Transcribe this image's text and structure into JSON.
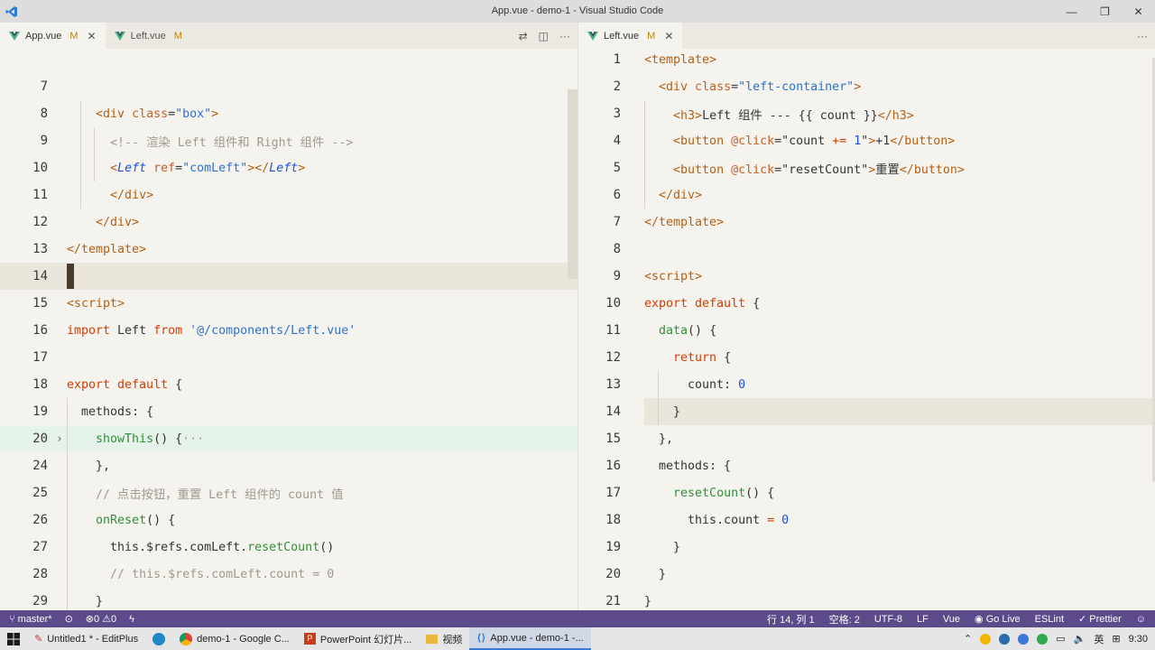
{
  "window": {
    "title": "App.vue - demo-1 - Visual Studio Code"
  },
  "left_group": {
    "tabs": [
      {
        "label": "App.vue",
        "status": "M",
        "active": true
      },
      {
        "label": "Left.vue",
        "status": "M",
        "active": false
      }
    ]
  },
  "right_group": {
    "tabs": [
      {
        "label": "Left.vue",
        "status": "M",
        "active": true
      }
    ]
  },
  "left_lines": [
    {
      "n": "7",
      "parts": []
    },
    {
      "n": "8",
      "parts": [
        [
          "plain",
          "    "
        ],
        [
          "tag",
          "<div "
        ],
        [
          "attr",
          "class"
        ],
        [
          "plain",
          "="
        ],
        [
          "str",
          "\"box\""
        ],
        [
          "tag",
          ">"
        ]
      ]
    },
    {
      "n": "9",
      "parts": [
        [
          "plain",
          "      "
        ],
        [
          "cmt",
          "<!-- 渲染 Left 组件和 Right 组件 -->"
        ]
      ]
    },
    {
      "n": "10",
      "parts": [
        [
          "plain",
          "      "
        ],
        [
          "tag",
          "<"
        ],
        [
          "it",
          "Left "
        ],
        [
          "attr",
          "ref"
        ],
        [
          "plain",
          "="
        ],
        [
          "str",
          "\"comLeft\""
        ],
        [
          "tag",
          "></"
        ],
        [
          "it",
          "Left"
        ],
        [
          "tag",
          ">"
        ]
      ]
    },
    {
      "n": "11",
      "parts": [
        [
          "plain",
          "      "
        ],
        [
          "tag",
          "</div>"
        ]
      ]
    },
    {
      "n": "12",
      "parts": [
        [
          "plain",
          "    "
        ],
        [
          "tag",
          "</div>"
        ]
      ]
    },
    {
      "n": "13",
      "parts": [
        [
          "tag",
          "</template>"
        ]
      ]
    },
    {
      "n": "14",
      "parts": []
    },
    {
      "n": "15",
      "parts": [
        [
          "tag",
          "<script>"
        ]
      ]
    },
    {
      "n": "16",
      "parts": [
        [
          "kw",
          "import "
        ],
        [
          "plain",
          "Left "
        ],
        [
          "kw",
          "from "
        ],
        [
          "str",
          "'@/components/Left.vue'"
        ]
      ]
    },
    {
      "n": "17",
      "parts": []
    },
    {
      "n": "18",
      "parts": [
        [
          "kw",
          "export default "
        ],
        [
          "plain",
          "{"
        ]
      ]
    },
    {
      "n": "19",
      "parts": [
        [
          "plain",
          "  methods: {"
        ]
      ]
    },
    {
      "n": "20",
      "parts": [
        [
          "plain",
          "    "
        ],
        [
          "fn",
          "showThis"
        ],
        [
          "plain",
          "() {"
        ],
        [
          "cmt",
          "···"
        ]
      ]
    },
    {
      "n": "24",
      "parts": [
        [
          "plain",
          "    },"
        ]
      ]
    },
    {
      "n": "25",
      "parts": [
        [
          "plain",
          "    "
        ],
        [
          "cmt",
          "// 点击按钮，重置 Left 组件的 count 值"
        ]
      ]
    },
    {
      "n": "26",
      "parts": [
        [
          "plain",
          "    "
        ],
        [
          "fn",
          "onReset"
        ],
        [
          "plain",
          "() {"
        ]
      ]
    },
    {
      "n": "27",
      "parts": [
        [
          "plain",
          "      this.$refs.comLeft."
        ],
        [
          "fn",
          "resetCount"
        ],
        [
          "plain",
          "()"
        ]
      ]
    },
    {
      "n": "28",
      "parts": [
        [
          "plain",
          "      "
        ],
        [
          "cmt",
          "// this.$refs.comLeft.count = 0"
        ]
      ]
    },
    {
      "n": "29",
      "parts": [
        [
          "plain",
          "    }"
        ]
      ]
    }
  ],
  "right_lines": [
    {
      "n": "1",
      "parts": [
        [
          "tag",
          "<template>"
        ]
      ]
    },
    {
      "n": "2",
      "parts": [
        [
          "plain",
          "  "
        ],
        [
          "tag",
          "<div "
        ],
        [
          "attr",
          "class"
        ],
        [
          "plain",
          "="
        ],
        [
          "str",
          "\"left-container\""
        ],
        [
          "tag",
          ">"
        ]
      ]
    },
    {
      "n": "3",
      "parts": [
        [
          "plain",
          "    "
        ],
        [
          "tag",
          "<h3>"
        ],
        [
          "plain",
          "Left 组件 --- {{ count }}"
        ],
        [
          "tag",
          "</h3>"
        ]
      ]
    },
    {
      "n": "4",
      "parts": [
        [
          "plain",
          "    "
        ],
        [
          "tag",
          "<button "
        ],
        [
          "attr",
          "@click"
        ],
        [
          "plain",
          "=\"count "
        ],
        [
          "kw",
          "+="
        ],
        [
          "plain",
          " "
        ],
        [
          "num",
          "1"
        ],
        [
          "plain",
          "\""
        ],
        [
          "tag",
          ">"
        ],
        [
          "plain",
          "+1"
        ],
        [
          "tag",
          "</button>"
        ]
      ]
    },
    {
      "n": "5",
      "parts": [
        [
          "plain",
          "    "
        ],
        [
          "tag",
          "<button "
        ],
        [
          "attr",
          "@click"
        ],
        [
          "plain",
          "=\"resetCount\""
        ],
        [
          "tag",
          ">"
        ],
        [
          "plain",
          "重置"
        ],
        [
          "tag",
          "</button>"
        ]
      ]
    },
    {
      "n": "6",
      "parts": [
        [
          "plain",
          "  "
        ],
        [
          "tag",
          "</div>"
        ]
      ]
    },
    {
      "n": "7",
      "parts": [
        [
          "tag",
          "</template>"
        ]
      ]
    },
    {
      "n": "8",
      "parts": []
    },
    {
      "n": "9",
      "parts": [
        [
          "tag",
          "<script>"
        ]
      ]
    },
    {
      "n": "10",
      "parts": [
        [
          "kw",
          "export default "
        ],
        [
          "plain",
          "{"
        ]
      ]
    },
    {
      "n": "11",
      "parts": [
        [
          "plain",
          "  "
        ],
        [
          "fn",
          "data"
        ],
        [
          "plain",
          "() {"
        ]
      ]
    },
    {
      "n": "12",
      "parts": [
        [
          "plain",
          "    "
        ],
        [
          "kw",
          "return "
        ],
        [
          "plain",
          "{"
        ]
      ]
    },
    {
      "n": "13",
      "parts": [
        [
          "plain",
          "      count: "
        ],
        [
          "num",
          "0"
        ]
      ]
    },
    {
      "n": "14",
      "parts": [
        [
          "plain",
          "    }"
        ]
      ]
    },
    {
      "n": "15",
      "parts": [
        [
          "plain",
          "  },"
        ]
      ]
    },
    {
      "n": "16",
      "parts": [
        [
          "plain",
          "  methods: {"
        ]
      ]
    },
    {
      "n": "17",
      "parts": [
        [
          "plain",
          "    "
        ],
        [
          "fn",
          "resetCount"
        ],
        [
          "plain",
          "() {"
        ]
      ]
    },
    {
      "n": "18",
      "parts": [
        [
          "plain",
          "      this.count "
        ],
        [
          "kw",
          "= "
        ],
        [
          "num",
          "0"
        ]
      ]
    },
    {
      "n": "19",
      "parts": [
        [
          "plain",
          "    }"
        ]
      ]
    },
    {
      "n": "20",
      "parts": [
        [
          "plain",
          "  }"
        ]
      ]
    },
    {
      "n": "21",
      "parts": [
        [
          "plain",
          "}"
        ]
      ]
    }
  ],
  "statusbar": {
    "branch": "master*",
    "problems": "⊗0 ⚠0",
    "position": "行 14, 列 1",
    "spaces": "空格: 2",
    "encoding": "UTF-8",
    "eol": "LF",
    "language": "Vue",
    "golive": "Go Live",
    "eslint": "ESLint",
    "prettier": "✓ Prettier"
  },
  "taskbar": {
    "items": [
      {
        "label": "Untitled1 * - EditPlus",
        "active": false
      },
      {
        "label": "",
        "active": false
      },
      {
        "label": "demo-1 - Google C...",
        "active": false
      },
      {
        "label": "PowerPoint 幻灯片...",
        "active": false
      },
      {
        "label": "视频",
        "active": false
      },
      {
        "label": "App.vue - demo-1 -...",
        "active": true
      }
    ],
    "ime": "英",
    "clock": "9:30"
  },
  "colors": {
    "statusbar": "#5d4a8a",
    "accent": "#3b78d8",
    "vue_green": "#41b883"
  }
}
